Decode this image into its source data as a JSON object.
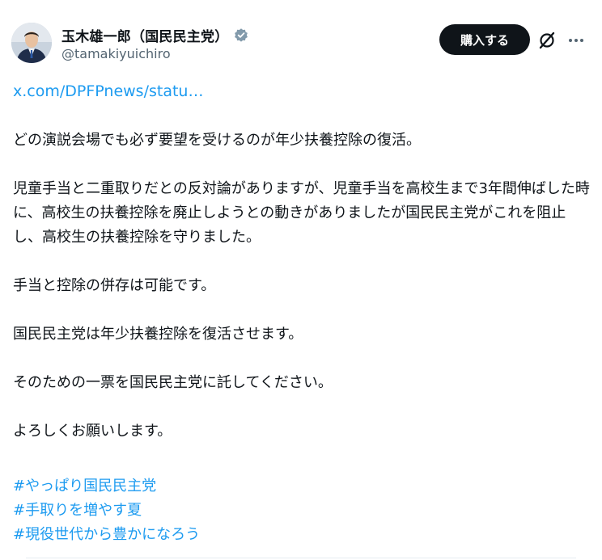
{
  "author": {
    "display_name": "玉木雄一郎（国民民主党）",
    "handle": "@tamakiyuichiro"
  },
  "actions": {
    "buy_label": "購入する"
  },
  "icons": {
    "verified": "verified-badge-icon",
    "grok": "grok-icon",
    "more": "more-options-icon"
  },
  "colors": {
    "link": "#1d9bf0",
    "verified": "#829aab",
    "button_bg": "#0f1419"
  },
  "tweet": {
    "link_text": "x.com/DPFPnews/statu…",
    "paragraphs": [
      "どの演説会場でも必ず要望を受けるのが年少扶養控除の復活。",
      "児童手当と二重取りだとの反対論がありますが、児童手当を高校生まで3年間伸ばした時に、高校生の扶養控除を廃止しようとの動きがありましたが国民民主党がこれを阻止し、高校生の扶養控除を守りました。",
      "手当と控除の併存は可能です。",
      "国民民主党は年少扶養控除を復活させます。",
      "そのための一票を国民民主党に託してください。",
      "よろしくお願いします。"
    ],
    "hashtags": [
      "#やっぱり国民民主党",
      "#手取りを増やす夏",
      "#現役世代から豊かになろう"
    ]
  }
}
